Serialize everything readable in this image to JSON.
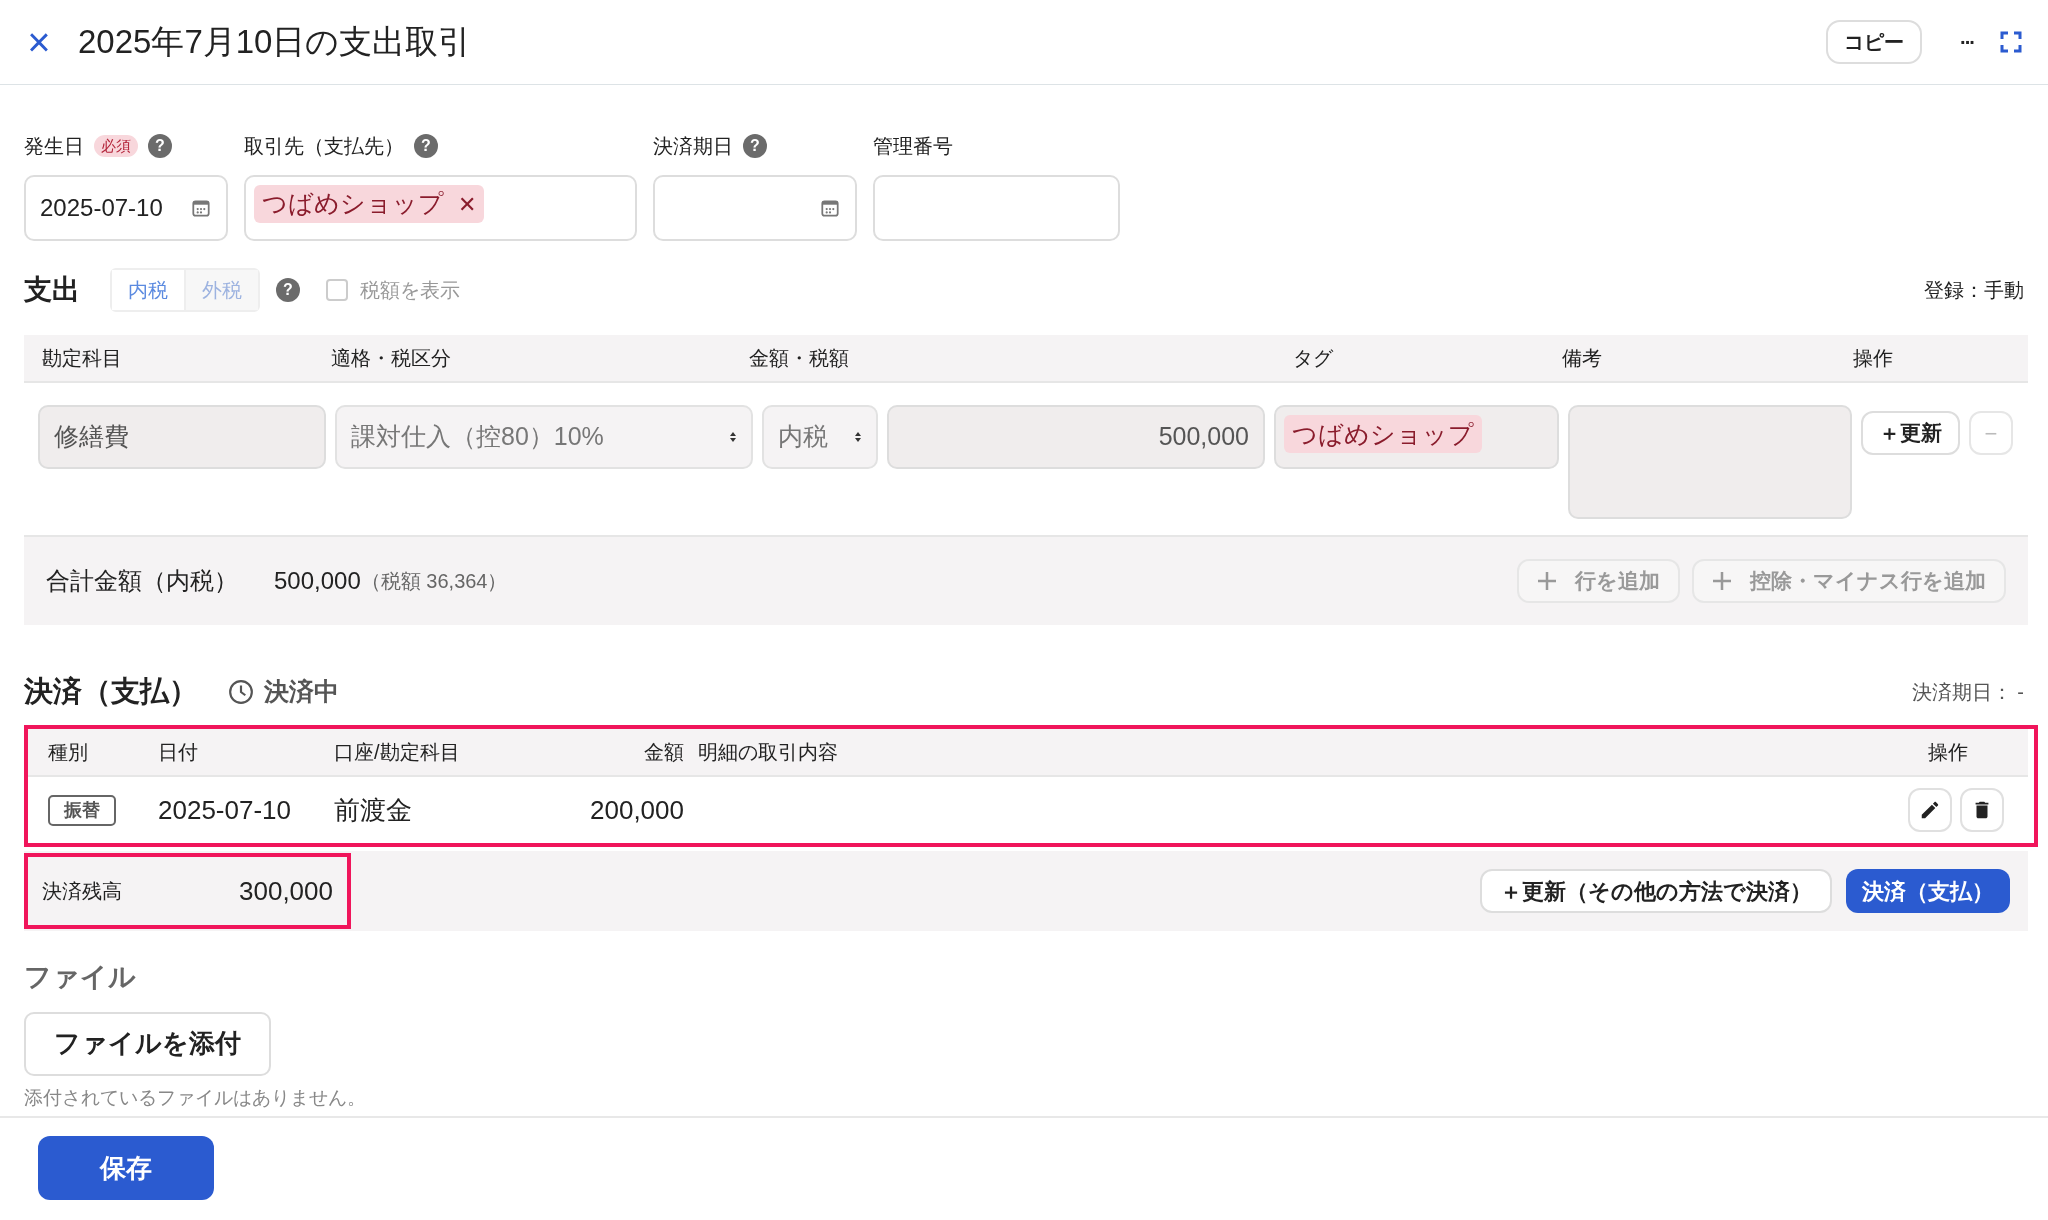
{
  "header": {
    "close": "×",
    "title": "2025年7月10日の支出取引",
    "copy_button": "コピー",
    "more": "···"
  },
  "fields": [
    {
      "label": "発生日",
      "required_badge": "必須",
      "help": "?",
      "kind": "date",
      "value": "2025-07-10"
    },
    {
      "label": "取引先（支払先）",
      "help": "?",
      "kind": "tag",
      "tag": "つばめショップ",
      "tag_remove": "✕"
    },
    {
      "label": "決済期日",
      "help": "?",
      "kind": "date"
    },
    {
      "label": "管理番号",
      "kind": "text"
    }
  ],
  "expense": {
    "title": "支出",
    "tax_modes": [
      {
        "label": "内税",
        "selected": true
      },
      {
        "label": "外税",
        "selected": false
      }
    ],
    "help": "?",
    "show_tax": {
      "label": "税額を表示",
      "checked": false
    },
    "registration": "登録：手動",
    "columns": [
      "勘定科目",
      "適格・税区分",
      "金額・税額",
      "タグ",
      "備考",
      "操作"
    ],
    "rows": [
      {
        "account": "修繕費",
        "tax_category": "課対仕入（控80）10%",
        "tax_mode": "内税",
        "amount": "500,000",
        "tag": "つばめショップ",
        "update_button": "＋更新",
        "remove_button": "−"
      }
    ],
    "total_label": "合計金額（内税）",
    "total": "500,000",
    "total_tax": "（税額 36,364）",
    "add_row": "行を追加",
    "add_minus_row": "控除・マイナス行を追加"
  },
  "settlement": {
    "title": "決済（支払）",
    "status": "決済中",
    "due_date": "決済期日： -",
    "columns": [
      "種別",
      "日付",
      "口座/勘定科目",
      "金額",
      "明細の取引内容",
      "操作"
    ],
    "rows": [
      {
        "type": "振替",
        "date": "2025-07-10",
        "account": "前渡金",
        "amount": "200,000"
      }
    ],
    "balance_label": "決済残高",
    "balance": "300,000",
    "other_method_button": "＋更新（その他の方法で決済）",
    "pay_button": "決済（支払）"
  },
  "files": {
    "title": "ファイル",
    "attach_button": "ファイルを添付",
    "empty_note": "添付されているファイルはありません。"
  },
  "save_button": "保存"
}
